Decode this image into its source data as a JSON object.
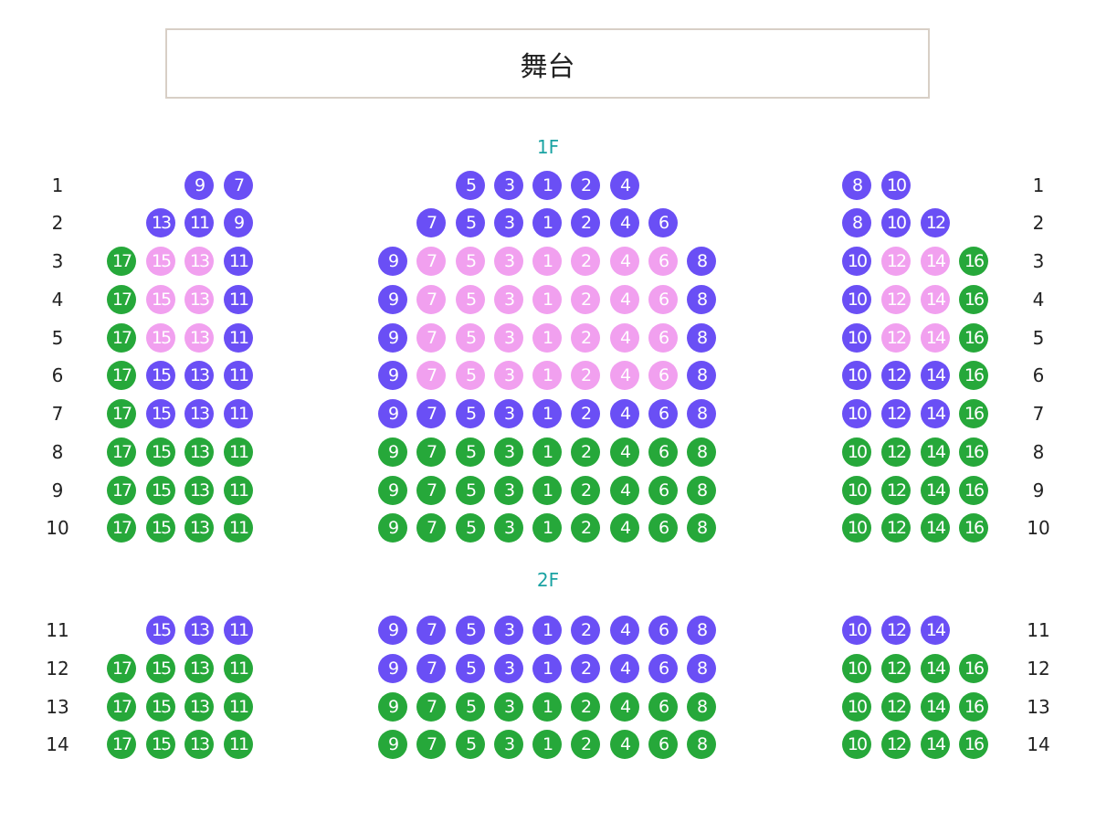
{
  "stage": {
    "label": "舞台"
  },
  "floors": [
    {
      "label": "1F"
    },
    {
      "label": "2F"
    }
  ],
  "colors": {
    "blue": "#6a4ff5",
    "pink": "#f1a0ef",
    "green": "#26a83a",
    "floor_label": "#1aa3a3"
  },
  "sections": {
    "left": [
      "17",
      "15",
      "13",
      "11",
      "9",
      "7"
    ],
    "center": [
      "9",
      "7",
      "5",
      "3",
      "1",
      "2",
      "4",
      "6",
      "8"
    ],
    "right": [
      "8",
      "10",
      "12",
      "14",
      "16"
    ]
  },
  "rows": [
    {
      "label": "1",
      "left": [
        null,
        null,
        null,
        null,
        "b",
        "b"
      ],
      "center": [
        null,
        null,
        "b",
        "b",
        "b",
        "b",
        "b",
        null,
        null
      ],
      "right": [
        "b",
        "b",
        null,
        null,
        null
      ]
    },
    {
      "label": "2",
      "left": [
        null,
        null,
        "b",
        "b",
        "b",
        null
      ],
      "center": [
        null,
        "b",
        "b",
        "b",
        "b",
        "b",
        "b",
        "b",
        null
      ],
      "right": [
        "b",
        "b",
        "b",
        null,
        null
      ]
    },
    {
      "label": "3",
      "left": [
        "g",
        "p",
        "p",
        "b",
        null,
        null
      ],
      "center": [
        "b",
        "p",
        "p",
        "p",
        "p",
        "p",
        "p",
        "p",
        "b"
      ],
      "right": [
        null,
        "b",
        "p",
        "p",
        "g"
      ]
    },
    {
      "label": "4",
      "left": [
        "g",
        "p",
        "p",
        "b",
        null,
        null
      ],
      "center": [
        "b",
        "p",
        "p",
        "p",
        "p",
        "p",
        "p",
        "p",
        "b"
      ],
      "right": [
        null,
        "b",
        "p",
        "p",
        "g"
      ]
    },
    {
      "label": "5",
      "left": [
        "g",
        "p",
        "p",
        "b",
        null,
        null
      ],
      "center": [
        "b",
        "p",
        "p",
        "p",
        "p",
        "p",
        "p",
        "p",
        "b"
      ],
      "right": [
        null,
        "b",
        "p",
        "p",
        "g"
      ]
    },
    {
      "label": "6",
      "left": [
        "g",
        "b",
        "b",
        "b",
        null,
        null
      ],
      "center": [
        "b",
        "p",
        "p",
        "p",
        "p",
        "p",
        "p",
        "p",
        "b"
      ],
      "right": [
        null,
        "b",
        "b",
        "b",
        "g"
      ]
    },
    {
      "label": "7",
      "left": [
        "g",
        "b",
        "b",
        "b",
        null,
        null
      ],
      "center": [
        "b",
        "b",
        "b",
        "b",
        "b",
        "b",
        "b",
        "b",
        "b"
      ],
      "right": [
        null,
        "b",
        "b",
        "b",
        "g"
      ]
    },
    {
      "label": "8",
      "left": [
        "g",
        "g",
        "g",
        "g",
        null,
        null
      ],
      "center": [
        "g",
        "g",
        "g",
        "g",
        "g",
        "g",
        "g",
        "g",
        "g"
      ],
      "right": [
        null,
        "g",
        "g",
        "g",
        "g"
      ]
    },
    {
      "label": "9",
      "left": [
        "g",
        "g",
        "g",
        "g",
        null,
        null
      ],
      "center": [
        "g",
        "g",
        "g",
        "g",
        "g",
        "g",
        "g",
        "g",
        "g"
      ],
      "right": [
        null,
        "g",
        "g",
        "g",
        "g"
      ]
    },
    {
      "label": "10",
      "left": [
        "g",
        "g",
        "g",
        "g",
        null,
        null
      ],
      "center": [
        "g",
        "g",
        "g",
        "g",
        "g",
        "g",
        "g",
        "g",
        "g"
      ],
      "right": [
        null,
        "g",
        "g",
        "g",
        "g"
      ]
    },
    {
      "label": "11",
      "left": [
        null,
        "b",
        "b",
        "b",
        null,
        null
      ],
      "center": [
        "b",
        "b",
        "b",
        "b",
        "b",
        "b",
        "b",
        "b",
        "b"
      ],
      "right": [
        null,
        "b",
        "b",
        "b",
        null
      ]
    },
    {
      "label": "12",
      "left": [
        "g",
        "g",
        "g",
        "g",
        null,
        null
      ],
      "center": [
        "b",
        "b",
        "b",
        "b",
        "b",
        "b",
        "b",
        "b",
        "b"
      ],
      "right": [
        null,
        "g",
        "g",
        "g",
        "g"
      ]
    },
    {
      "label": "13",
      "left": [
        "g",
        "g",
        "g",
        "g",
        null,
        null
      ],
      "center": [
        "g",
        "g",
        "g",
        "g",
        "g",
        "g",
        "g",
        "g",
        "g"
      ],
      "right": [
        null,
        "g",
        "g",
        "g",
        "g"
      ]
    },
    {
      "label": "14",
      "left": [
        "g",
        "g",
        "g",
        "g",
        null,
        null
      ],
      "center": [
        "g",
        "g",
        "g",
        "g",
        "g",
        "g",
        "g",
        "g",
        "g"
      ],
      "right": [
        null,
        "g",
        "g",
        "g",
        "g"
      ]
    }
  ]
}
